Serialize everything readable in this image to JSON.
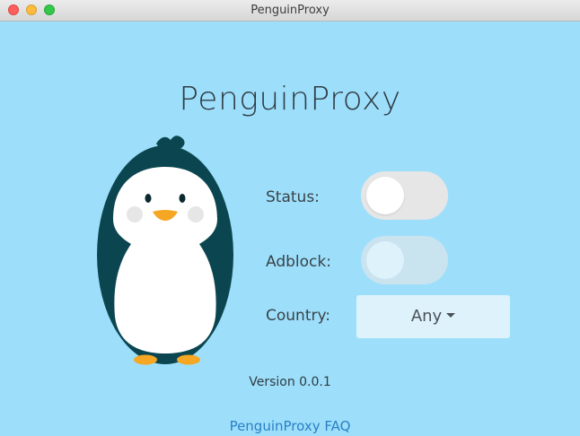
{
  "window": {
    "title": "PenguinProxy",
    "background_color": "#9ddffb"
  },
  "app": {
    "title": "PenguinProxy",
    "mascot_icon": "penguin-icon"
  },
  "settings": {
    "status": {
      "label": "Status:",
      "enabled": false
    },
    "adblock": {
      "label": "Adblock:",
      "enabled": false,
      "disabled_look": true
    },
    "country": {
      "label": "Country:",
      "selected": "Any"
    }
  },
  "footer": {
    "version": "Version 0.0.1",
    "faq_link": "PenguinProxy FAQ",
    "link_color": "#2a7fc5"
  }
}
